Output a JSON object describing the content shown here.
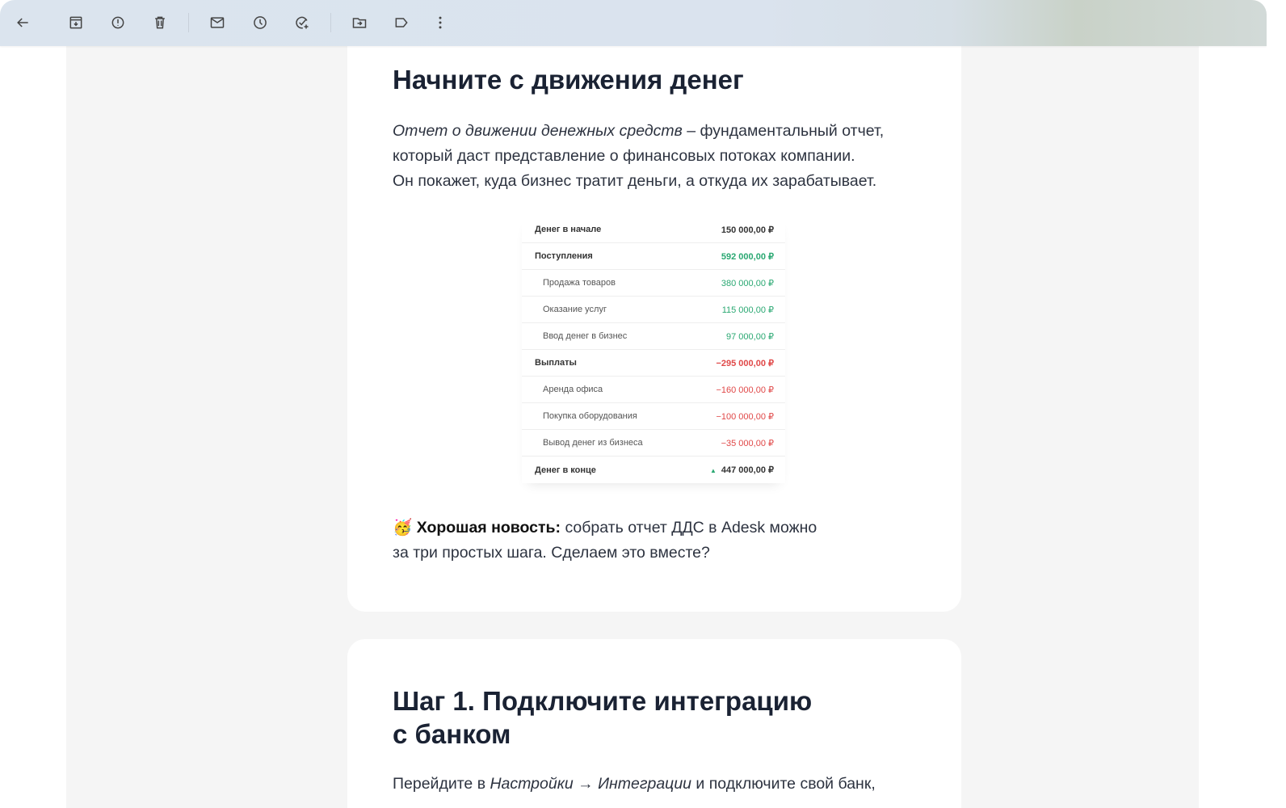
{
  "toolbar": {
    "icons": [
      "back-arrow-icon",
      "archive-icon",
      "report-spam-icon",
      "delete-icon",
      "mark-unread-icon",
      "snooze-icon",
      "add-task-icon",
      "move-to-icon",
      "label-icon",
      "more-icon"
    ]
  },
  "section1": {
    "title": "Начните с движения денег",
    "intro_italic": "Отчет о движении денежных средств",
    "intro_rest": " – фундаментальный отчет,",
    "line2": "который даст представление о финансовых потоках компании.",
    "line3": "Он покажет, куда бизнес тратит деньги, а откуда их зарабатывает.",
    "table": [
      {
        "label": "Денег в начале",
        "value": "150 000,00 ₽",
        "type": "total",
        "color": "neutral"
      },
      {
        "label": "Поступления",
        "value": "592 000,00 ₽",
        "type": "total",
        "color": "green"
      },
      {
        "label": "Продажа товаров",
        "value": "380 000,00 ₽",
        "type": "sub",
        "color": "green"
      },
      {
        "label": "Оказание услуг",
        "value": "115 000,00 ₽",
        "type": "sub",
        "color": "green"
      },
      {
        "label": "Ввод денег в бизнес",
        "value": "97 000,00 ₽",
        "type": "sub",
        "color": "green"
      },
      {
        "label": "Выплаты",
        "value": "−295 000,00 ₽",
        "type": "total",
        "color": "red"
      },
      {
        "label": "Аренда офиса",
        "value": "−160 000,00 ₽",
        "type": "sub",
        "color": "red"
      },
      {
        "label": "Покупка оборудования",
        "value": "−100 000,00 ₽",
        "type": "sub",
        "color": "red"
      },
      {
        "label": "Вывод денег из бизнеса",
        "value": "−35 000,00 ₽",
        "type": "sub",
        "color": "red"
      },
      {
        "label": "Денег в конце",
        "value": "447 000,00 ₽",
        "type": "total",
        "color": "neutral",
        "trend": "▲"
      }
    ],
    "news_emoji": "🥳",
    "news_bold": "Хорошая новость:",
    "news_rest": " собрать отчет ДДС в Adesk можно",
    "news_line2": "за три простых шага. Сделаем это вместе?"
  },
  "section2": {
    "title_line1": "Шаг 1. Подключите интеграцию",
    "title_line2": "с банком",
    "p_start": "Перейдите в ",
    "p_italic": "Настройки → Интеграции",
    "p_rest": " и подключите свой банк,"
  },
  "colors": {
    "green": "#2aa872",
    "red": "#e04848",
    "toolbar": "#dbe4ee"
  }
}
